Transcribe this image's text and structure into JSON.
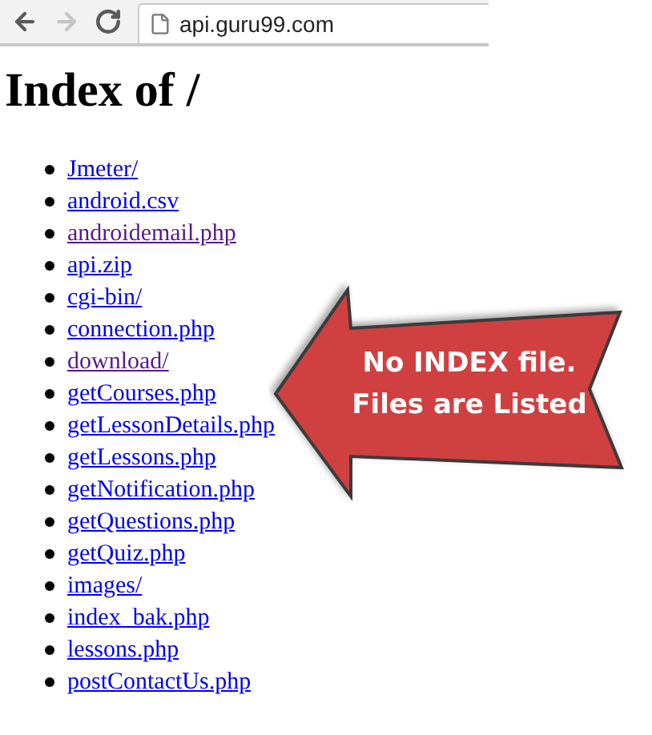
{
  "toolbar": {
    "back": {
      "disabled": false
    },
    "forward": {
      "disabled": true
    },
    "url": "api.guru99.com"
  },
  "heading": "Index of /",
  "files": [
    {
      "name": "Jmeter/",
      "visited": false
    },
    {
      "name": "android.csv",
      "visited": false
    },
    {
      "name": "androidemail.php",
      "visited": true
    },
    {
      "name": "api.zip",
      "visited": false
    },
    {
      "name": "cgi-bin/",
      "visited": false
    },
    {
      "name": "connection.php",
      "visited": false
    },
    {
      "name": "download/",
      "visited": true
    },
    {
      "name": "getCourses.php",
      "visited": false
    },
    {
      "name": "getLessonDetails.php",
      "visited": false
    },
    {
      "name": "getLessons.php",
      "visited": false
    },
    {
      "name": "getNotification.php",
      "visited": false
    },
    {
      "name": "getQuestions.php",
      "visited": false
    },
    {
      "name": "getQuiz.php",
      "visited": false
    },
    {
      "name": "images/",
      "visited": false
    },
    {
      "name": "index_bak.php",
      "visited": false
    },
    {
      "name": "lessons.php",
      "visited": false
    },
    {
      "name": "postContactUs.php",
      "visited": false
    }
  ],
  "callout": {
    "lines": [
      "No INDEX file.",
      "Files are Listed"
    ]
  }
}
